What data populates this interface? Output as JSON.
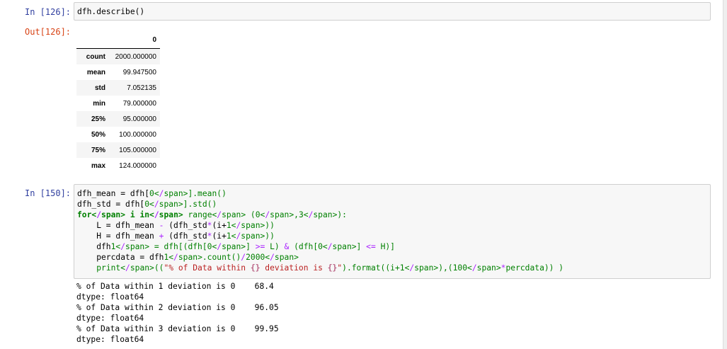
{
  "cell1": {
    "in_prompt": "In [126]:",
    "code": "dfh.describe()",
    "out_prompt": "Out[126]:",
    "table": {
      "column_header": "0",
      "rows": [
        {
          "label": "count",
          "value": "2000.000000"
        },
        {
          "label": "mean",
          "value": "99.947500"
        },
        {
          "label": "std",
          "value": "7.052135"
        },
        {
          "label": "min",
          "value": "79.000000"
        },
        {
          "label": "25%",
          "value": "95.000000"
        },
        {
          "label": "50%",
          "value": "100.000000"
        },
        {
          "label": "75%",
          "value": "105.000000"
        },
        {
          "label": "max",
          "value": "124.000000"
        }
      ]
    }
  },
  "cell2": {
    "in_prompt": "In [150]:",
    "code_lines": [
      "dfh_mean = dfh[0].mean()",
      "dfh_std = dfh[0].std()",
      "for i in range (0,3):",
      "    L = dfh_mean - (dfh_std*(i+1))",
      "    H = dfh_mean + (dfh_std*(i+1))",
      "    dfh1 = dfh[(dfh[0] >= L) & (dfh[0] <= H)]",
      "    percdata = dfh1.count()/2000",
      "    print((\"% of Data within {} deviation is {}\").format((i+1),(100*percdata)) )"
    ],
    "output_lines": [
      "% of Data within 1 deviation is 0    68.4",
      "dtype: float64",
      "% of Data within 2 deviation is 0    96.05",
      "dtype: float64",
      "% of Data within 3 deviation is 0    99.95",
      "dtype: float64"
    ]
  }
}
